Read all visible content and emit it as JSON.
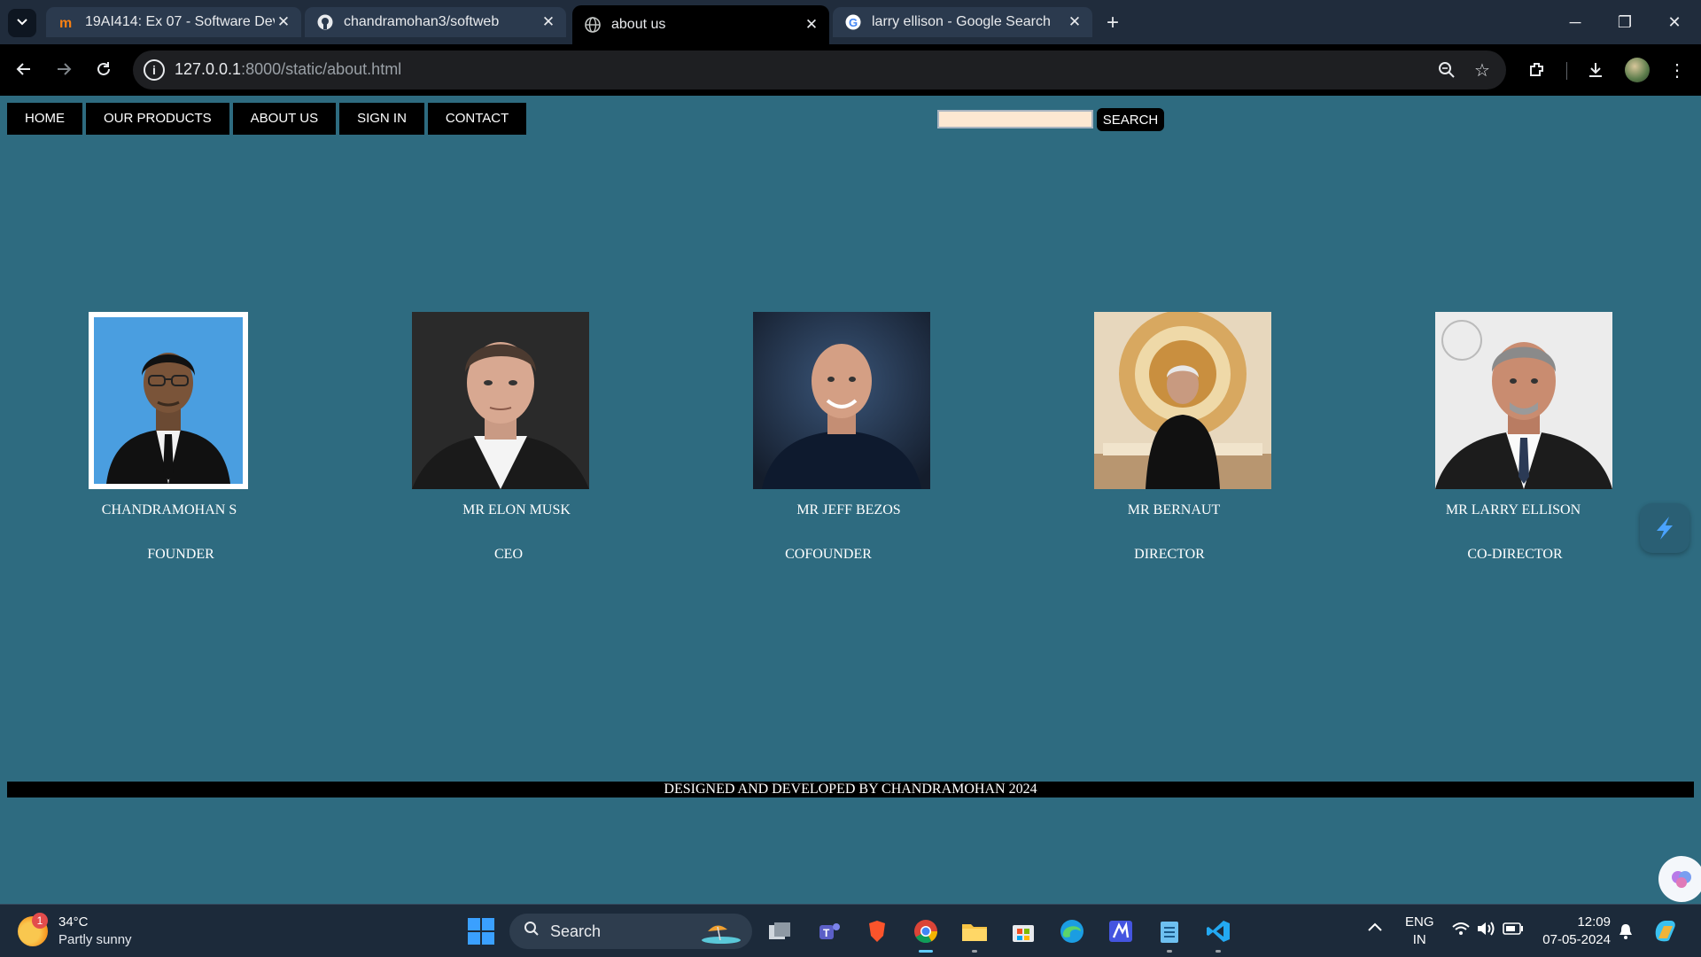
{
  "browser": {
    "tabs": [
      {
        "title": "19AI414: Ex 07 - Software Devel",
        "icon": "moodle-icon",
        "active": false
      },
      {
        "title": "chandramohan3/softweb",
        "icon": "github-icon",
        "active": false
      },
      {
        "title": "about us",
        "icon": "globe-icon",
        "active": true
      },
      {
        "title": "larry ellison - Google Search",
        "icon": "google-icon",
        "active": false
      }
    ],
    "url_host": "127.0.0.1",
    "url_rest": ":8000/static/about.html"
  },
  "page": {
    "nav": [
      "HOME",
      "OUR PRODUCTS",
      "ABOUT US",
      "SIGN IN",
      "CONTACT"
    ],
    "search_button": "SEARCH",
    "search_value": "",
    "team": [
      {
        "name": "CHANDRAMOHAN S",
        "role": "FOUNDER"
      },
      {
        "name": "MR ELON MUSK",
        "role": "CEO"
      },
      {
        "name": "MR JEFF BEZOS",
        "role": "COFOUNDER"
      },
      {
        "name": "MR BERNAUT",
        "role": "DIRECTOR"
      },
      {
        "name": "MR LARRY ELLISON",
        "role": "CO-DIRECTOR"
      }
    ],
    "footer": "DESIGNED AND DEVELOPED BY CHANDRAMOHAN 2024"
  },
  "taskbar": {
    "weather_temp": "34°C",
    "weather_desc": "Partly sunny",
    "weather_badge": "1",
    "search_label": "Search",
    "lang_top": "ENG",
    "lang_bottom": "IN",
    "time": "12:09",
    "date": "07-05-2024"
  },
  "colors": {
    "page_bg": "#2e6b80",
    "nav_bg": "#000000",
    "search_field_bg": "#fde8d2",
    "accent": "#60cdff"
  }
}
